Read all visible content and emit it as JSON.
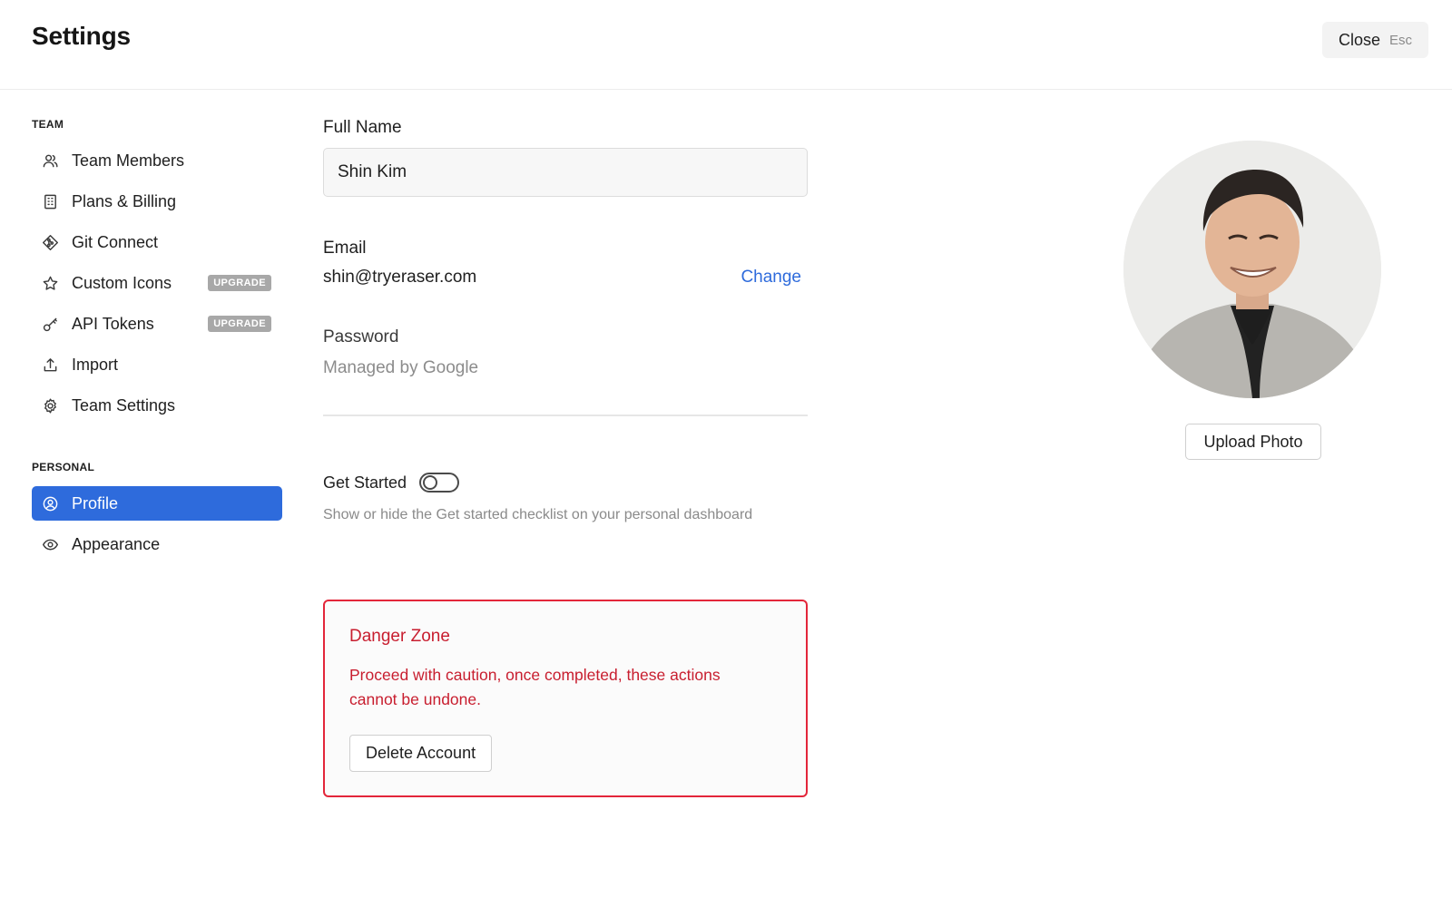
{
  "header": {
    "title": "Settings",
    "close_label": "Close",
    "close_hint": "Esc"
  },
  "sidebar": {
    "team_section_label": "TEAM",
    "team_items": [
      {
        "label": "Team Members",
        "icon": "users-icon"
      },
      {
        "label": "Plans & Billing",
        "icon": "building-icon"
      },
      {
        "label": "Git Connect",
        "icon": "git-icon"
      },
      {
        "label": "Custom Icons",
        "icon": "star-icon",
        "badge": "UPGRADE"
      },
      {
        "label": "API Tokens",
        "icon": "key-icon",
        "badge": "UPGRADE"
      },
      {
        "label": "Import",
        "icon": "upload-icon"
      },
      {
        "label": "Team Settings",
        "icon": "gear-icon"
      }
    ],
    "personal_section_label": "PERSONAL",
    "personal_items": [
      {
        "label": "Profile",
        "icon": "user-circle-icon",
        "active": true
      },
      {
        "label": "Appearance",
        "icon": "eye-icon"
      }
    ]
  },
  "profile": {
    "full_name_label": "Full Name",
    "full_name_value": "Shin Kim",
    "email_label": "Email",
    "email_value": "shin@tryeraser.com",
    "change_label": "Change",
    "password_label": "Password",
    "password_value": "Managed by Google",
    "get_started_label": "Get Started",
    "get_started_enabled": false,
    "get_started_description": "Show or hide the Get started checklist on your personal dashboard"
  },
  "danger_zone": {
    "title": "Danger Zone",
    "description": "Proceed with caution, once completed, these actions cannot be undone.",
    "delete_label": "Delete Account"
  },
  "photo": {
    "upload_label": "Upload Photo"
  },
  "colors": {
    "accent": "#2e6bdc",
    "danger": "#c81e2f",
    "badge": "#a8a8a8"
  }
}
